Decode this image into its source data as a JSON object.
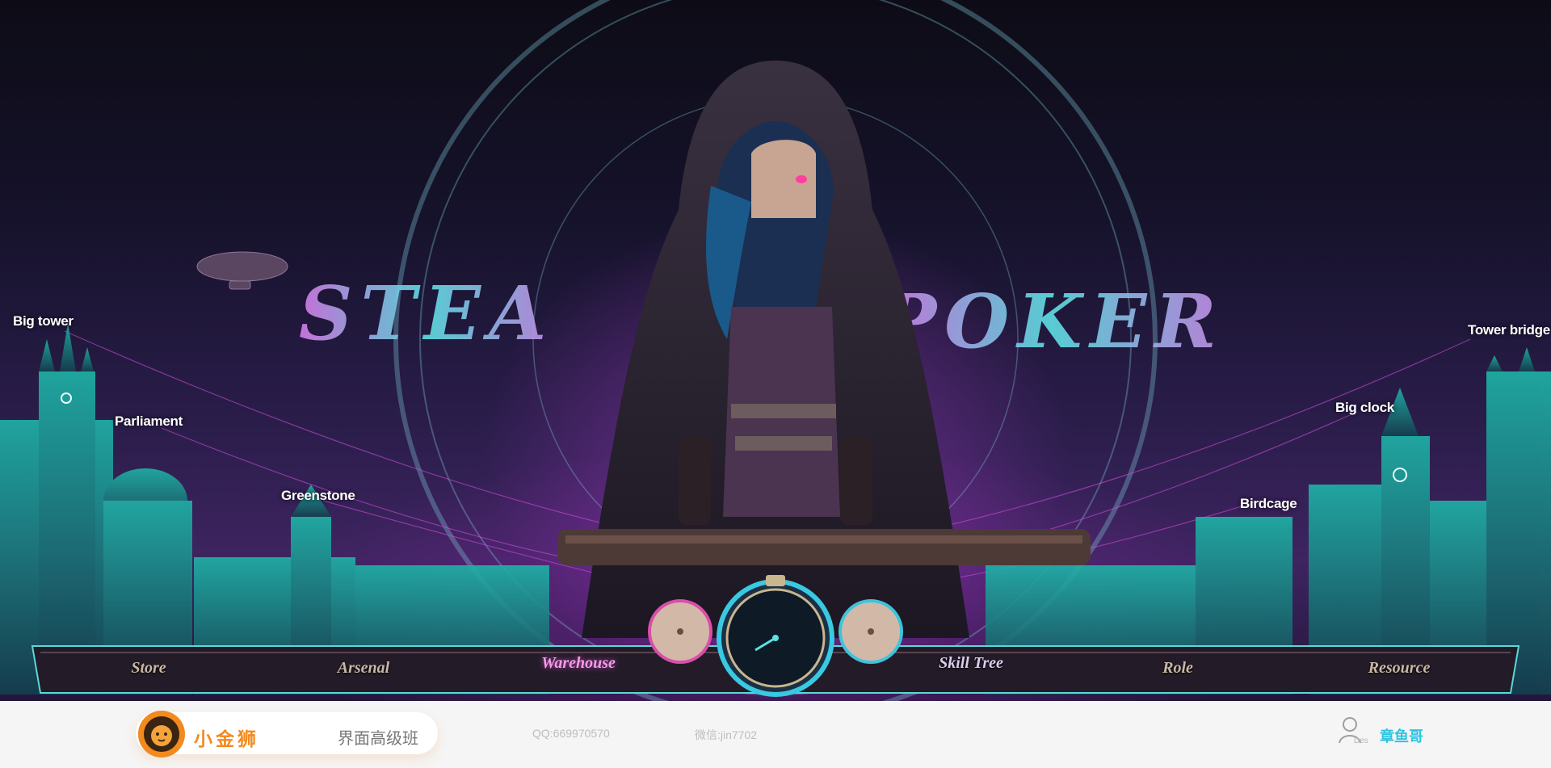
{
  "game": {
    "logo_text_left": "STEA",
    "logo_text_right": "POKER"
  },
  "map": {
    "locations": [
      {
        "key": "big_tower",
        "label": "Big tower"
      },
      {
        "key": "parliament",
        "label": "Parliament"
      },
      {
        "key": "greenstone",
        "label": "Greenstone"
      },
      {
        "key": "birdcage",
        "label": "Birdcage"
      },
      {
        "key": "big_clock",
        "label": "Big clock"
      },
      {
        "key": "tower_bridge",
        "label": "Tower bridge"
      }
    ]
  },
  "nav": {
    "items": [
      {
        "label": "Store",
        "active": false
      },
      {
        "label": "Arsenal",
        "active": false
      },
      {
        "label": "Warehouse",
        "active": true
      },
      {
        "label": "Skill Tree",
        "active": false
      },
      {
        "label": "Role",
        "active": false
      },
      {
        "label": "Resource",
        "active": false
      }
    ],
    "clock_icon": "pocket-watch-icon"
  },
  "footer": {
    "brand_name": "小金狮",
    "brand_sub": "界面高级班",
    "qq": "QQ:669970570",
    "wechat": "微信:jin7702",
    "user_des": "Des",
    "user_name": "章鱼哥"
  },
  "colors": {
    "accent_cyan": "#2fc4e0",
    "accent_pink": "#f49be8",
    "brand_orange": "#f28a1e"
  }
}
